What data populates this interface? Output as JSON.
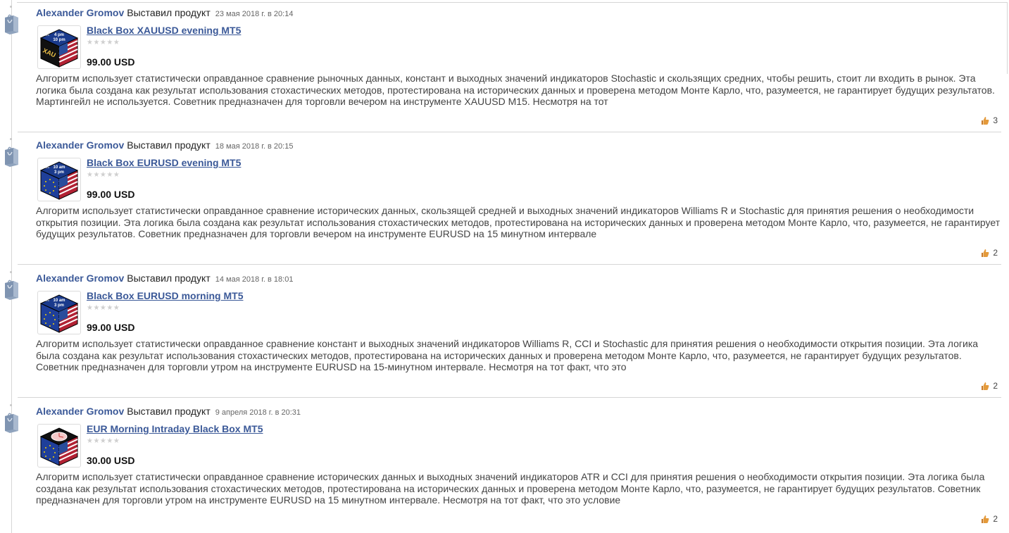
{
  "entries": [
    {
      "author": "Alexander Gromov",
      "action": "Выставил продукт",
      "date": "23 мая 2018 г. в 20:14",
      "product_title": "Black Box XAUUSD evening MT5",
      "price": "99.00 USD",
      "description": "Алгоритм использует статистически оправданное сравнение рыночных данных, констант и выходных значений индикаторов Stochastic и скользящих средних, чтобы решить, стоит ли входить в рынок. Эта логика была создана как результат использования стохастических методов, протестирована на исторических данных и проверена методом Монте Карло, что, разумеется, не гарантирует будущих результатов. Мартингейл не используется. Советник предназначен для торговли вечером на инструменте XAUUSD M15. Несмотря на тот",
      "likes": "3",
      "rating_stars": 0,
      "thumb": {
        "line1": "4 pm",
        "line2": "10 pm",
        "front": "XAU",
        "side": "15m",
        "kind": "gold"
      }
    },
    {
      "author": "Alexander Gromov",
      "action": "Выставил продукт",
      "date": "18 мая 2018 г. в 20:15",
      "product_title": "Black Box EURUSD evening MT5",
      "price": "99.00 USD",
      "description": "Алгоритм использует статистически оправданное сравнение исторических данных, скользящей средней и выходных значений индикаторов Williams R и Stochastic для принятия решения о необходимости открытия позиции. Эта логика была создана как результат использования стохастических методов, протестирована на исторических данных и проверена методом Монте Карло, что, разумеется, не гарантирует будущих результатов. Советник предназначен для торговли вечером на инструменте EURUSD на 15 минутном интервале",
      "likes": "2",
      "rating_stars": 0,
      "thumb": {
        "line1": "10 am",
        "line2": "3 pm",
        "front": "",
        "side": "15m",
        "kind": "eu"
      }
    },
    {
      "author": "Alexander Gromov",
      "action": "Выставил продукт",
      "date": "14 мая 2018 г. в 18:01",
      "product_title": "Black Box EURUSD morning MT5",
      "price": "99.00 USD",
      "description": "Алгоритм использует статистически оправданное сравнение констант и выходных значений индикаторов Williams R, CCI и Stochastic для принятия решения о необходимости открытия позиции. Эта логика была создана как результат использования стохастических методов, протестирована на исторических данных и проверена методом Монте Карло, что, разумеется, не гарантирует будущих результатов. Советник предназначен для торговли утром на инструменте EURUSD на 15-минутном интервале. Несмотря на тот факт, что это",
      "likes": "2",
      "rating_stars": 0,
      "thumb": {
        "line1": "10 am",
        "line2": "3 pm",
        "front": "",
        "side": "15m",
        "kind": "eu"
      }
    },
    {
      "author": "Alexander Gromov",
      "action": "Выставил продукт",
      "date": "9 апреля 2018 г. в 20:31",
      "product_title": "EUR Morning Intraday Black Box MT5",
      "price": "30.00 USD",
      "description": "Алгоритм использует статистически оправданное сравнение исторических данных и выходных значений индикаторов ATR и CCI для принятия решения о необходимости открытия позиции. Эта логика была создана как результат использования стохастических методов, протестирована на исторических данных и проверена методом Монте Карло, что, разумеется, не гарантирует будущих результатов. Советник предназначен для торговли утром на инструменте EURUSD на 15 минутном интервале. Несмотря на тот факт, что это условие",
      "likes": "2",
      "rating_stars": 0,
      "thumb": {
        "line1": "",
        "line2": "",
        "front": "",
        "side": "",
        "kind": "clock"
      }
    }
  ],
  "icons": {
    "timeline": "shopping-bag-icon",
    "like": "thumbs-up-icon"
  },
  "colors": {
    "link": "#3b5998",
    "border": "#d6d6d6",
    "bag": "#8fa3bd",
    "like": "#e49a3b"
  }
}
